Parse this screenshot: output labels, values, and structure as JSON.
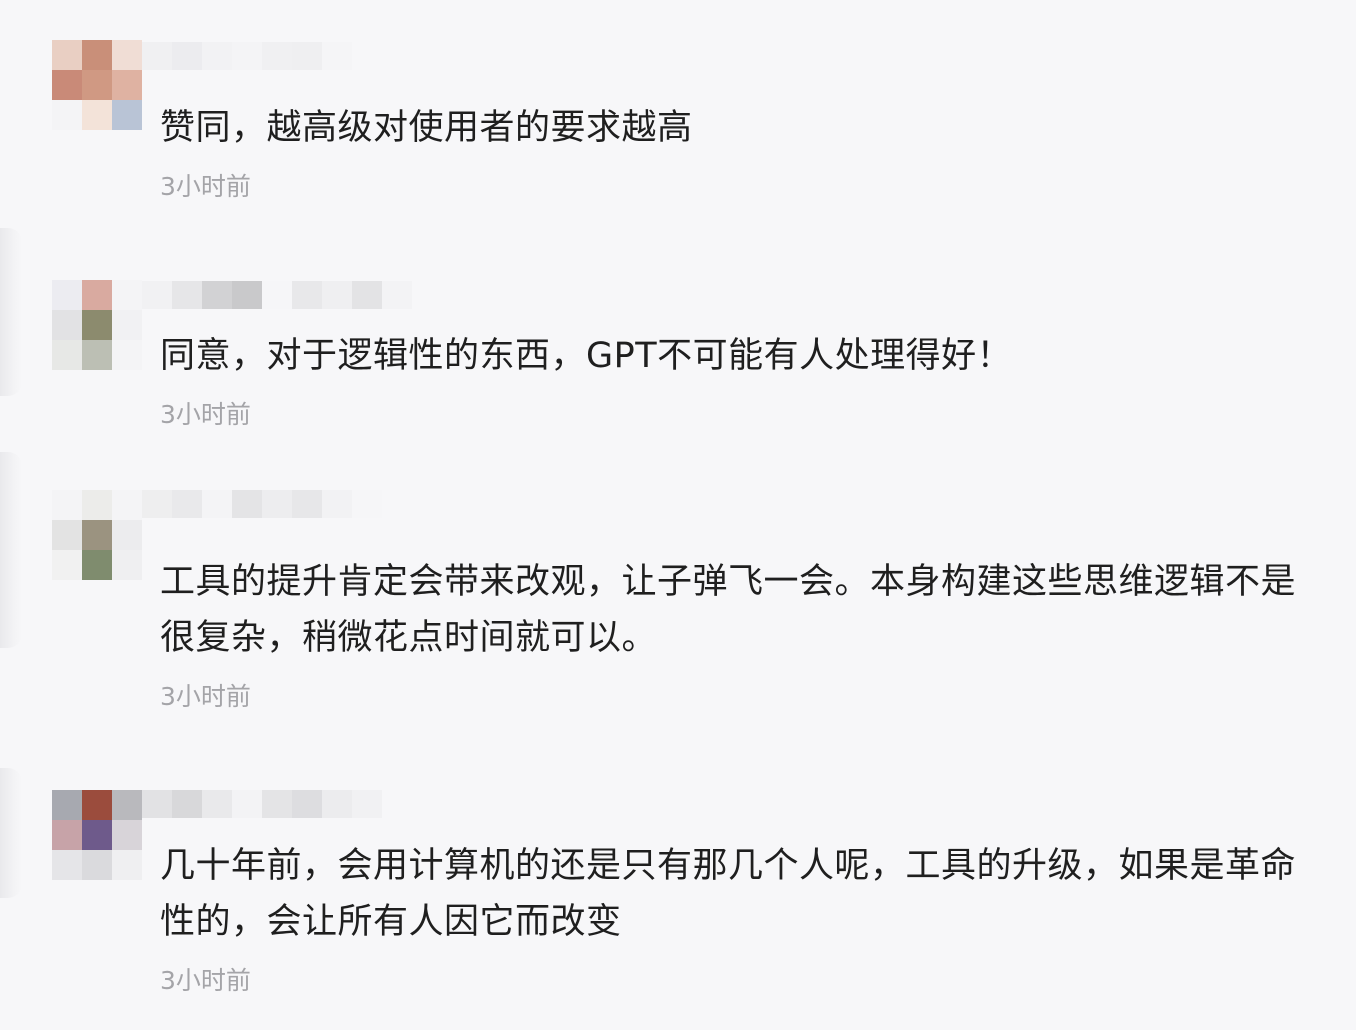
{
  "comments": [
    {
      "text": "赞同，越高级对使用者的要求越高",
      "time": "3小时前",
      "avatar_colors": [
        "#e9cfc3",
        "#c98f79",
        "#f0ddd5",
        "#c98a78",
        "#d09983",
        "#dfb2a2",
        "#f4f4f6",
        "#f3e3d9",
        "#b9c4d6"
      ],
      "nickname_colors": [
        "#f0f0f2",
        "#ececef",
        "#f2f2f4",
        "#f4f4f6",
        "#f0f0f2",
        "#efeff1",
        "#f5f5f7"
      ]
    },
    {
      "text": "同意，对于逻辑性的东西，GPT不可能有人处理得好！",
      "time": "3小时前",
      "avatar_colors": [
        "#ececf1",
        "#d9aaa0",
        "#f4f4f6",
        "#e2e2e4",
        "#8c8b6e",
        "#f1f1f3",
        "#e7e8e6",
        "#bcbfb4",
        "#f4f4f6"
      ],
      "nickname_colors": [
        "#f1f1f3",
        "#e6e6e8",
        "#d2d2d4",
        "#c9c9cb",
        "#f6f6f8",
        "#e8e8ea",
        "#efeff1",
        "#e3e3e5",
        "#f3f3f5"
      ]
    },
    {
      "text": "工具的提升肯定会带来改观，让子弹飞一会。本身构建这些思维逻辑不是很复杂，稍微花点时间就可以。",
      "time": "3小时前",
      "avatar_colors": [
        "#f4f4f6",
        "#ececea",
        "#f4f4f6",
        "#e3e3e3",
        "#9b9380",
        "#ececee",
        "#f1f1f1",
        "#7f8c6e",
        "#efeff1"
      ],
      "nickname_colors": [
        "#eeeeef",
        "#e9e9eb",
        "#f4f4f6",
        "#e4e4e6",
        "#ededef",
        "#e7e7e9",
        "#f2f2f4",
        "#f6f6f8"
      ]
    },
    {
      "text": "几十年前，会用计算机的还是只有那几个人呢，工具的升级，如果是革命性的，会让所有人因它而改变",
      "time": "3小时前",
      "avatar_colors": [
        "#a7a9b0",
        "#9b4c3d",
        "#b9b9bd",
        "#c7a3a8",
        "#6e5a8b",
        "#d8d4d9",
        "#e5e5e8",
        "#dadadd",
        "#efeff1"
      ],
      "nickname_colors": [
        "#e2e2e4",
        "#d8d8da",
        "#e9e9eb",
        "#f3f3f5",
        "#e4e4e6",
        "#dddde0",
        "#ececee",
        "#f1f1f3"
      ]
    }
  ]
}
